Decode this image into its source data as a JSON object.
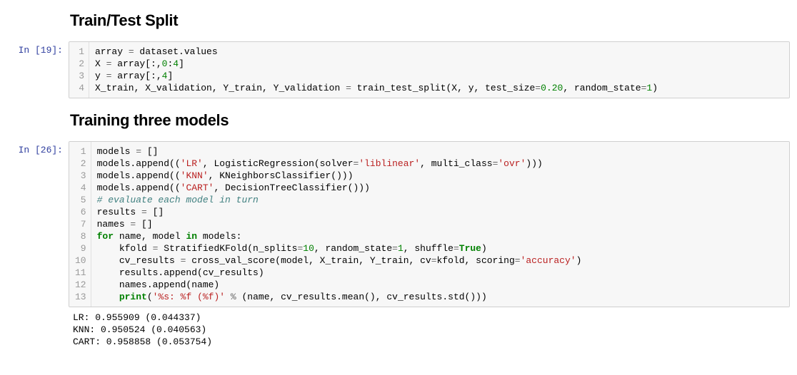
{
  "cells": [
    {
      "type": "markdown",
      "heading": "Train/Test Split"
    },
    {
      "type": "code",
      "prompt": "In [19]:",
      "lines": [
        [
          {
            "t": "array "
          },
          {
            "t": "=",
            "c": "op"
          },
          {
            "t": " dataset.values"
          }
        ],
        [
          {
            "t": "X "
          },
          {
            "t": "=",
            "c": "op"
          },
          {
            "t": " array[:,"
          },
          {
            "t": "0",
            "c": "num"
          },
          {
            "t": ":"
          },
          {
            "t": "4",
            "c": "num"
          },
          {
            "t": "]"
          }
        ],
        [
          {
            "t": "y "
          },
          {
            "t": "=",
            "c": "op"
          },
          {
            "t": " array[:,"
          },
          {
            "t": "4",
            "c": "num"
          },
          {
            "t": "]"
          }
        ],
        [
          {
            "t": "X_train, X_validation, Y_train, Y_validation "
          },
          {
            "t": "=",
            "c": "op"
          },
          {
            "t": " train_test_split(X, y, test_size"
          },
          {
            "t": "=",
            "c": "op"
          },
          {
            "t": "0.20",
            "c": "num"
          },
          {
            "t": ", random_state"
          },
          {
            "t": "=",
            "c": "op"
          },
          {
            "t": "1",
            "c": "num"
          },
          {
            "t": ")"
          }
        ]
      ]
    },
    {
      "type": "markdown",
      "heading": "Training three models"
    },
    {
      "type": "code",
      "prompt": "In [26]:",
      "lines": [
        [
          {
            "t": "models "
          },
          {
            "t": "=",
            "c": "op"
          },
          {
            "t": " []"
          }
        ],
        [
          {
            "t": "models.append(("
          },
          {
            "t": "'LR'",
            "c": "str"
          },
          {
            "t": ", LogisticRegression(solver"
          },
          {
            "t": "=",
            "c": "op"
          },
          {
            "t": "'liblinear'",
            "c": "str"
          },
          {
            "t": ", multi_class"
          },
          {
            "t": "=",
            "c": "op"
          },
          {
            "t": "'ovr'",
            "c": "str"
          },
          {
            "t": ")))"
          }
        ],
        [
          {
            "t": "models.append(("
          },
          {
            "t": "'KNN'",
            "c": "str"
          },
          {
            "t": ", KNeighborsClassifier()))"
          }
        ],
        [
          {
            "t": "models.append(("
          },
          {
            "t": "'CART'",
            "c": "str"
          },
          {
            "t": ", DecisionTreeClassifier()))"
          }
        ],
        [
          {
            "t": "# evaluate each model in turn",
            "c": "cm"
          }
        ],
        [
          {
            "t": "results "
          },
          {
            "t": "=",
            "c": "op"
          },
          {
            "t": " []"
          }
        ],
        [
          {
            "t": "names "
          },
          {
            "t": "=",
            "c": "op"
          },
          {
            "t": " []"
          }
        ],
        [
          {
            "t": "for",
            "c": "kw"
          },
          {
            "t": " name, model "
          },
          {
            "t": "in",
            "c": "kw"
          },
          {
            "t": " models:"
          }
        ],
        [
          {
            "t": "    kfold "
          },
          {
            "t": "=",
            "c": "op"
          },
          {
            "t": " StratifiedKFold(n_splits"
          },
          {
            "t": "=",
            "c": "op"
          },
          {
            "t": "10",
            "c": "num"
          },
          {
            "t": ", random_state"
          },
          {
            "t": "=",
            "c": "op"
          },
          {
            "t": "1",
            "c": "num"
          },
          {
            "t": ", shuffle"
          },
          {
            "t": "=",
            "c": "op"
          },
          {
            "t": "True",
            "c": "kw"
          },
          {
            "t": ")"
          }
        ],
        [
          {
            "t": "    cv_results "
          },
          {
            "t": "=",
            "c": "op"
          },
          {
            "t": " cross_val_score(model, X_train, Y_train, cv"
          },
          {
            "t": "=",
            "c": "op"
          },
          {
            "t": "kfold, scoring"
          },
          {
            "t": "=",
            "c": "op"
          },
          {
            "t": "'accuracy'",
            "c": "str"
          },
          {
            "t": ")"
          }
        ],
        [
          {
            "t": "    results.append(cv_results)"
          }
        ],
        [
          {
            "t": "    names.append(name)"
          }
        ],
        [
          {
            "t": "    "
          },
          {
            "t": "print",
            "c": "kw"
          },
          {
            "t": "("
          },
          {
            "t": "'%s: %f (%f)'",
            "c": "str"
          },
          {
            "t": " "
          },
          {
            "t": "%",
            "c": "op"
          },
          {
            "t": " (name, cv_results.mean(), cv_results.std()))"
          }
        ]
      ],
      "output": "LR: 0.955909 (0.044337)\nKNN: 0.950524 (0.040563)\nCART: 0.958858 (0.053754)"
    }
  ]
}
